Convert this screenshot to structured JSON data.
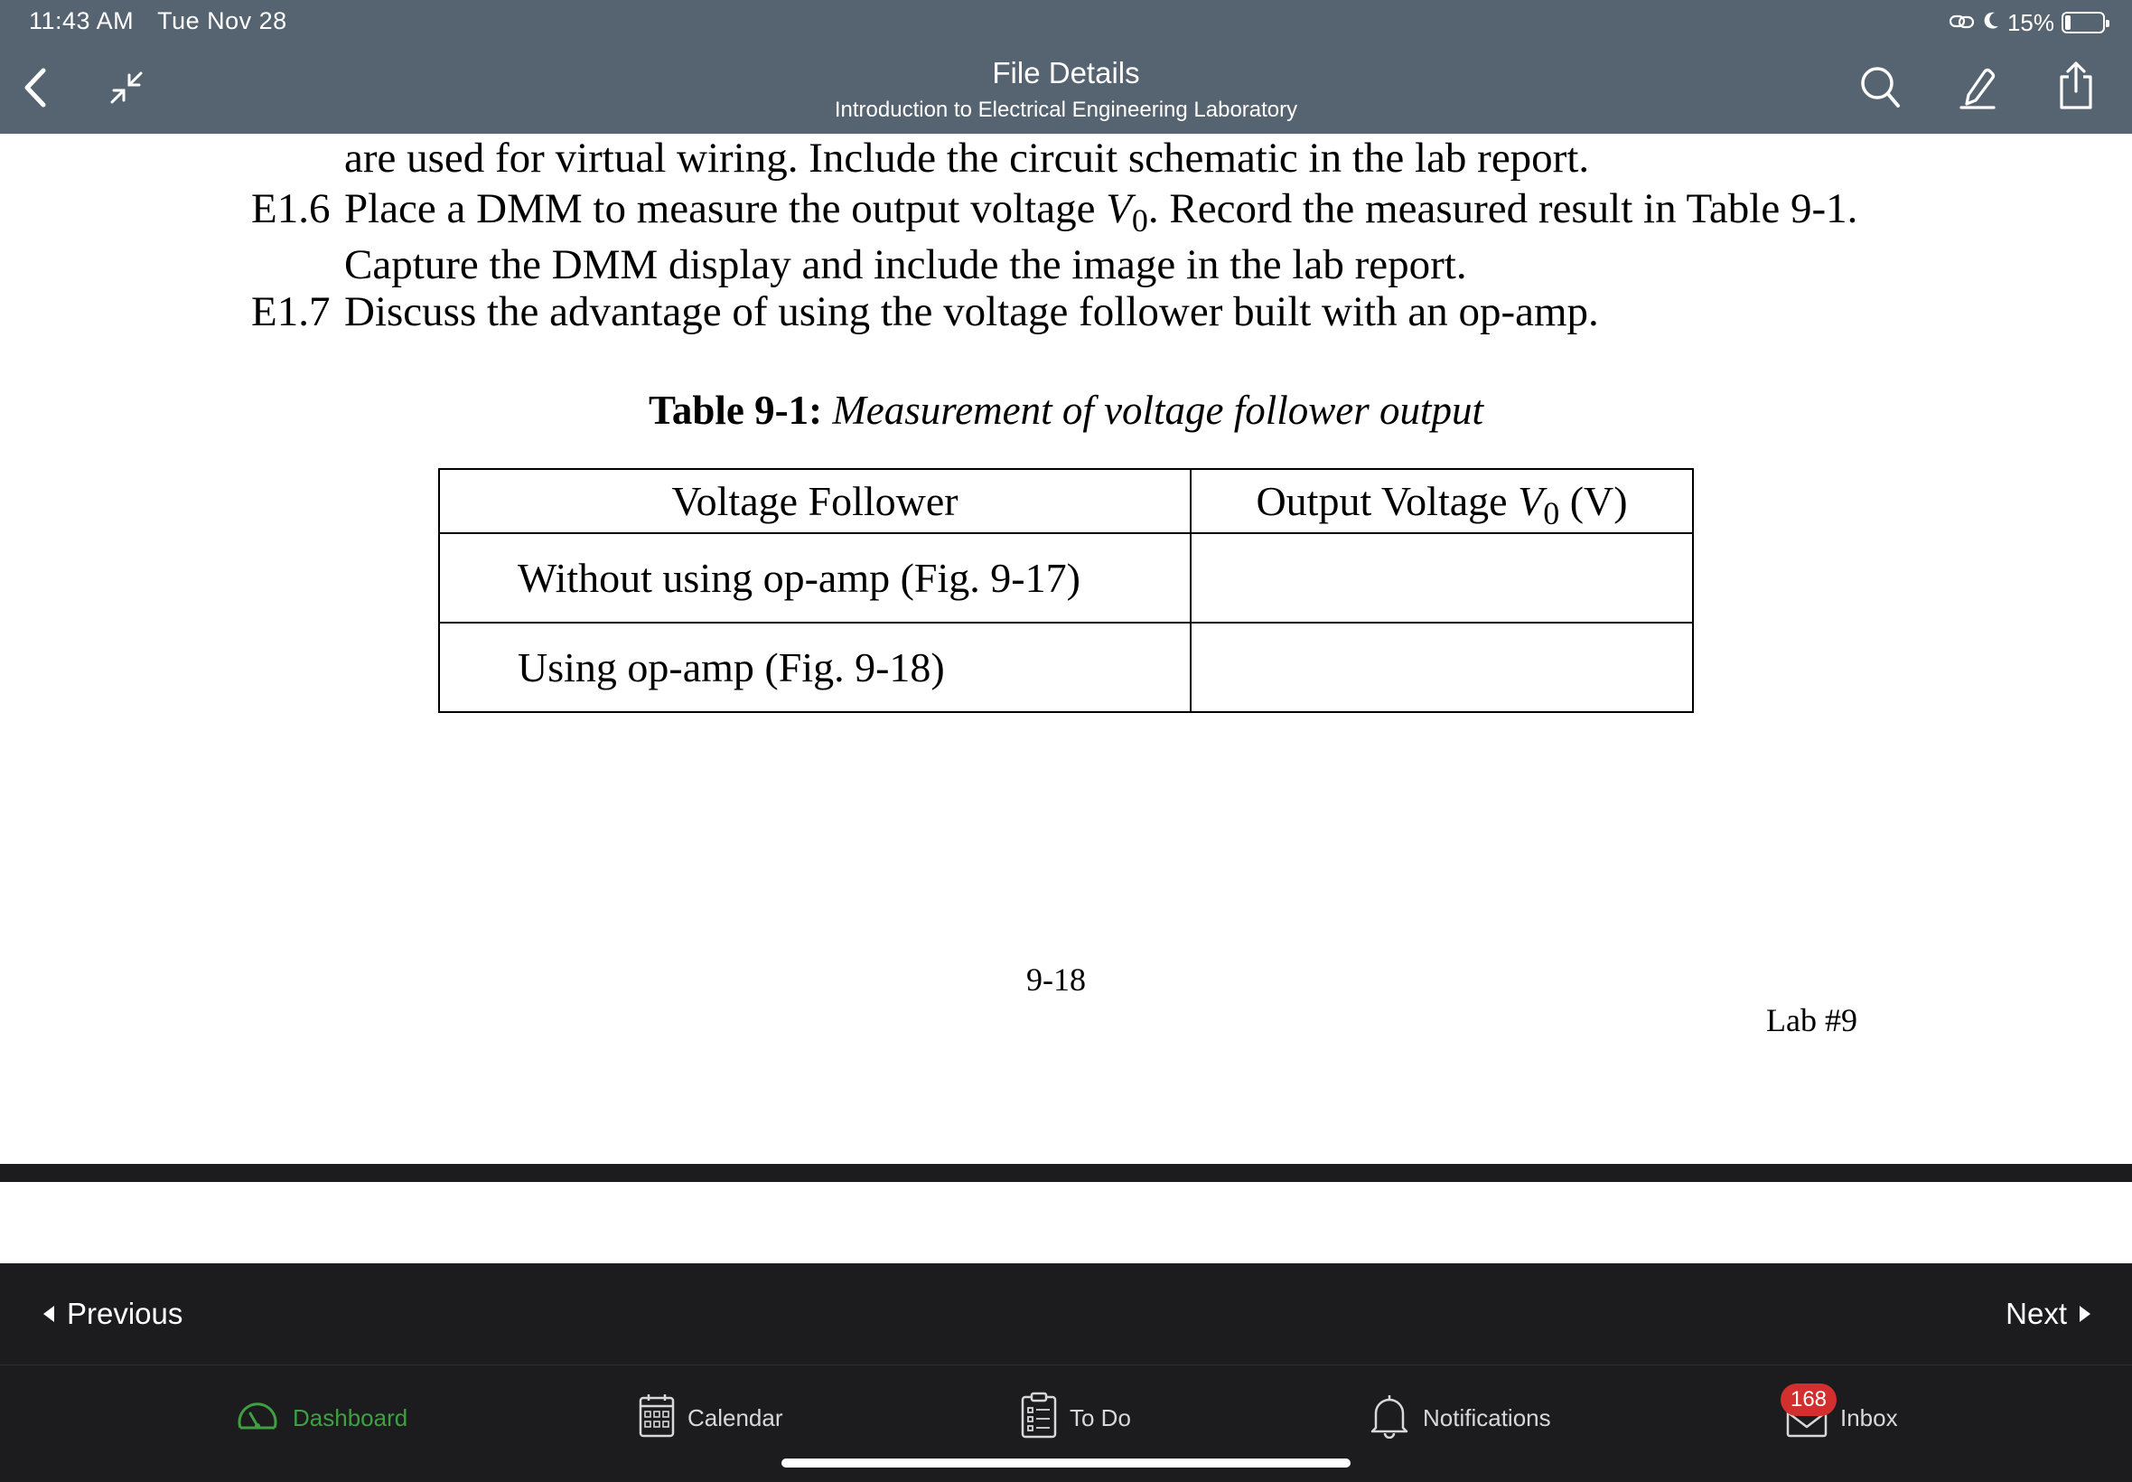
{
  "status_bar": {
    "time": "11:43 AM",
    "date": "Tue Nov 28",
    "battery": "15%",
    "battery_level": 0.15
  },
  "header": {
    "title": "File Details",
    "subtitle": "Introduction to Electrical Engineering Laboratory"
  },
  "document": {
    "line_1": "are used for virtual wiring. Include the circuit schematic in the lab report.",
    "step_e16": {
      "number": "E1.6",
      "text_before": "Place a DMM to measure the output voltage",
      "symbol": "V",
      "subscript": "0",
      "text_after": ". Record the measured result in Table 9-1.",
      "continuation": "Capture the DMM display and include the image in the lab report."
    },
    "step_e17": {
      "number": "E1.7",
      "text": "Discuss the advantage of using the voltage follower built with an op-amp."
    },
    "table": {
      "caption_label": "Table 9-1:",
      "caption_text": "Measurement of voltage follower output",
      "header_col1": "Voltage Follower",
      "header_col2_before": "Output Voltage",
      "header_col2_symbol": "V",
      "header_col2_subscript": "0",
      "header_col2_after": "(V)",
      "rows": [
        {
          "label": "Without using op-amp (Fig. 9-17)",
          "value": ""
        },
        {
          "label": "Using op-amp (Fig. 9-18)",
          "value": ""
        }
      ]
    },
    "page_number": "9-18",
    "lab_label": "Lab #9"
  },
  "pager": {
    "previous": "Previous",
    "next": "Next"
  },
  "tabs": {
    "dashboard": "Dashboard",
    "calendar": "Calendar",
    "todo": "To Do",
    "notifications": "Notifications",
    "inbox": "Inbox",
    "inbox_badge": "168"
  },
  "colors": {
    "header_bg": "#566370",
    "bar_bg": "#1c1c1e",
    "active_tab": "#3f9f42",
    "badge": "#d32f2f"
  },
  "icons": {
    "back": "chevron-left-icon",
    "collapse": "collapse-arrows-icon",
    "search": "search-icon",
    "annotate": "pen-icon",
    "share": "share-icon"
  }
}
